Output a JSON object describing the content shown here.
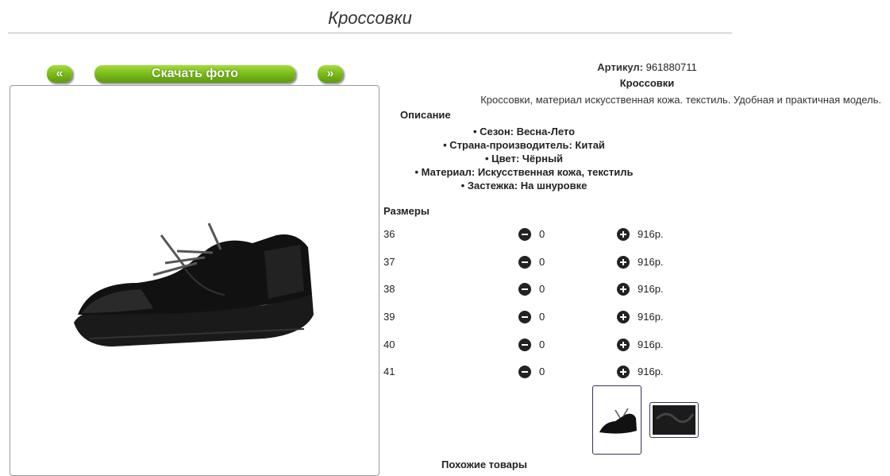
{
  "page": {
    "title": "Кроссовки"
  },
  "gallery": {
    "prev_label": "«",
    "download_label": "Скачать фото",
    "next_label": "»"
  },
  "product": {
    "article_label": "Артикул:",
    "article_value": "961880711",
    "name": "Кроссовки",
    "description": "Кроссовки, материал искусственная кожа. текстиль. Удобная и практичная модель.",
    "description_heading": "Описание",
    "specs": [
      "Сезон: Весна-Лето",
      "Страна-производитель: Китай",
      "Цвет: Чёрный",
      "Материал: Искусственная кожа, текстиль",
      "Застежка: На шнуровке"
    ]
  },
  "sizes": {
    "heading": "Размеры",
    "rows": [
      {
        "size": "36",
        "qty": "0",
        "price": "916р."
      },
      {
        "size": "37",
        "qty": "0",
        "price": "916р."
      },
      {
        "size": "38",
        "qty": "0",
        "price": "916р."
      },
      {
        "size": "39",
        "qty": "0",
        "price": "916р."
      },
      {
        "size": "40",
        "qty": "0",
        "price": "916р."
      },
      {
        "size": "41",
        "qty": "0",
        "price": "916р."
      }
    ]
  },
  "similar_heading": "Похожие товары",
  "colors": {
    "button_green": "#7fbf1c",
    "text": "#222222"
  }
}
